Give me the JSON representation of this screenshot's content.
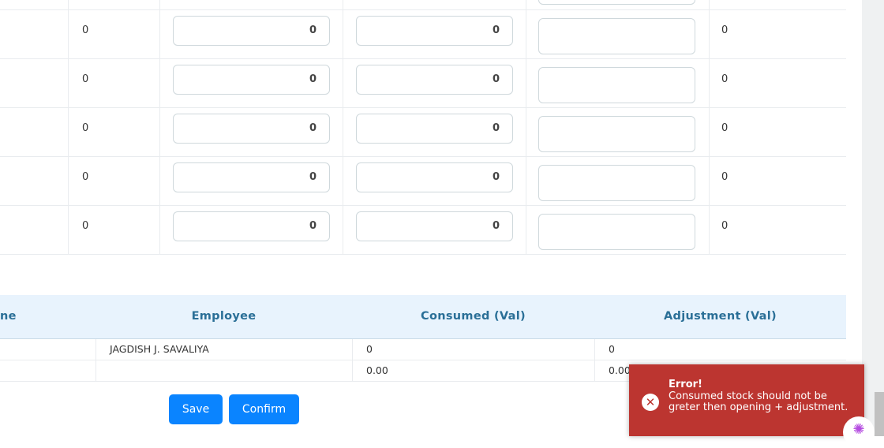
{
  "upper_rows": [
    {
      "col1": "0",
      "input1": "0",
      "input2": "0",
      "col5": "0"
    },
    {
      "col1": "0",
      "input1": "0",
      "input2": "0",
      "col5": "0"
    },
    {
      "col1": "0",
      "input1": "0",
      "input2": "0",
      "col5": "0"
    },
    {
      "col1": "0",
      "input1": "0",
      "input2": "0",
      "col5": "0"
    },
    {
      "col1": "0",
      "input1": "0",
      "input2": "0",
      "col5": "0"
    }
  ],
  "lower_table": {
    "headers": [
      "ne",
      "Employee",
      "Consumed (Val)",
      "Adjustment (Val)"
    ],
    "rows": [
      {
        "name": "",
        "employee": "JAGDISH J. SAVALIYA",
        "consumed": "0",
        "adjustment": "0"
      },
      {
        "name": "",
        "employee": "",
        "consumed": "0.00",
        "adjustment": "0.00"
      }
    ]
  },
  "buttons": {
    "save": "Save",
    "confirm": "Confirm"
  },
  "toast": {
    "title": "Error!",
    "message": "Consumed stock should not be greter then opening + adjustment.",
    "color": "#bc3530"
  },
  "colors": {
    "accent": "#0a84ff",
    "header_text": "#2a6f97",
    "header_bg": "#e8f3fd"
  }
}
